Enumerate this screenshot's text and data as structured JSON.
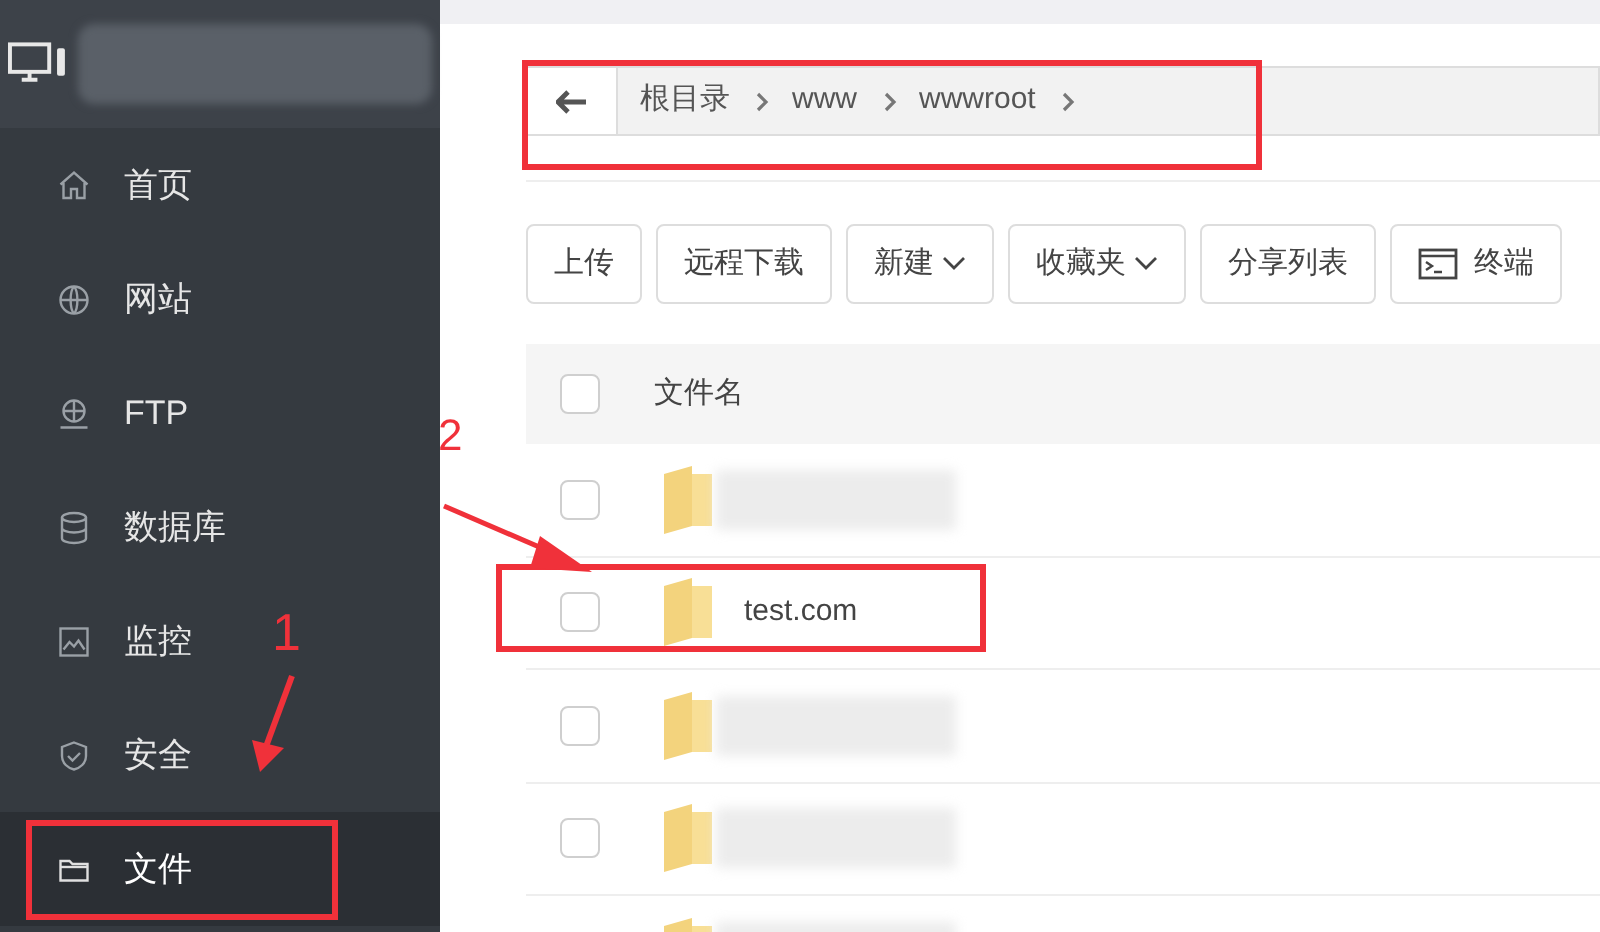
{
  "sidebar": {
    "items": [
      {
        "label": "首页",
        "selected": false,
        "highlighted": false
      },
      {
        "label": "网站",
        "selected": false,
        "highlighted": false
      },
      {
        "label": "FTP",
        "selected": false,
        "highlighted": false
      },
      {
        "label": "数据库",
        "selected": false,
        "highlighted": false
      },
      {
        "label": "监控",
        "selected": false,
        "highlighted": false
      },
      {
        "label": "安全",
        "selected": false,
        "highlighted": false
      },
      {
        "label": "文件",
        "selected": true,
        "highlighted": true
      }
    ]
  },
  "breadcrumb": {
    "highlighted": true,
    "path": [
      "根目录",
      "www",
      "wwwroot"
    ]
  },
  "toolbar": [
    {
      "label": "上传",
      "kind": "plain"
    },
    {
      "label": "远程下载",
      "kind": "plain"
    },
    {
      "label": "新建",
      "kind": "dropdown"
    },
    {
      "label": "收藏夹",
      "kind": "dropdown"
    },
    {
      "label": "分享列表",
      "kind": "plain"
    },
    {
      "label": "终端",
      "kind": "terminal"
    }
  ],
  "table": {
    "header_checked": false,
    "columns": [
      "文件名"
    ],
    "rows": [
      {
        "kind": "blurred",
        "checked": false,
        "highlighted": false
      },
      {
        "kind": "named",
        "name": "test.com",
        "checked": false,
        "highlighted": true
      },
      {
        "kind": "blurred",
        "checked": false,
        "highlighted": false
      },
      {
        "kind": "blurred",
        "checked": false,
        "highlighted": false
      },
      {
        "kind": "blurred",
        "highlighted": false
      }
    ]
  },
  "annotations": [
    {
      "label": "1"
    },
    {
      "label": "2"
    }
  ]
}
